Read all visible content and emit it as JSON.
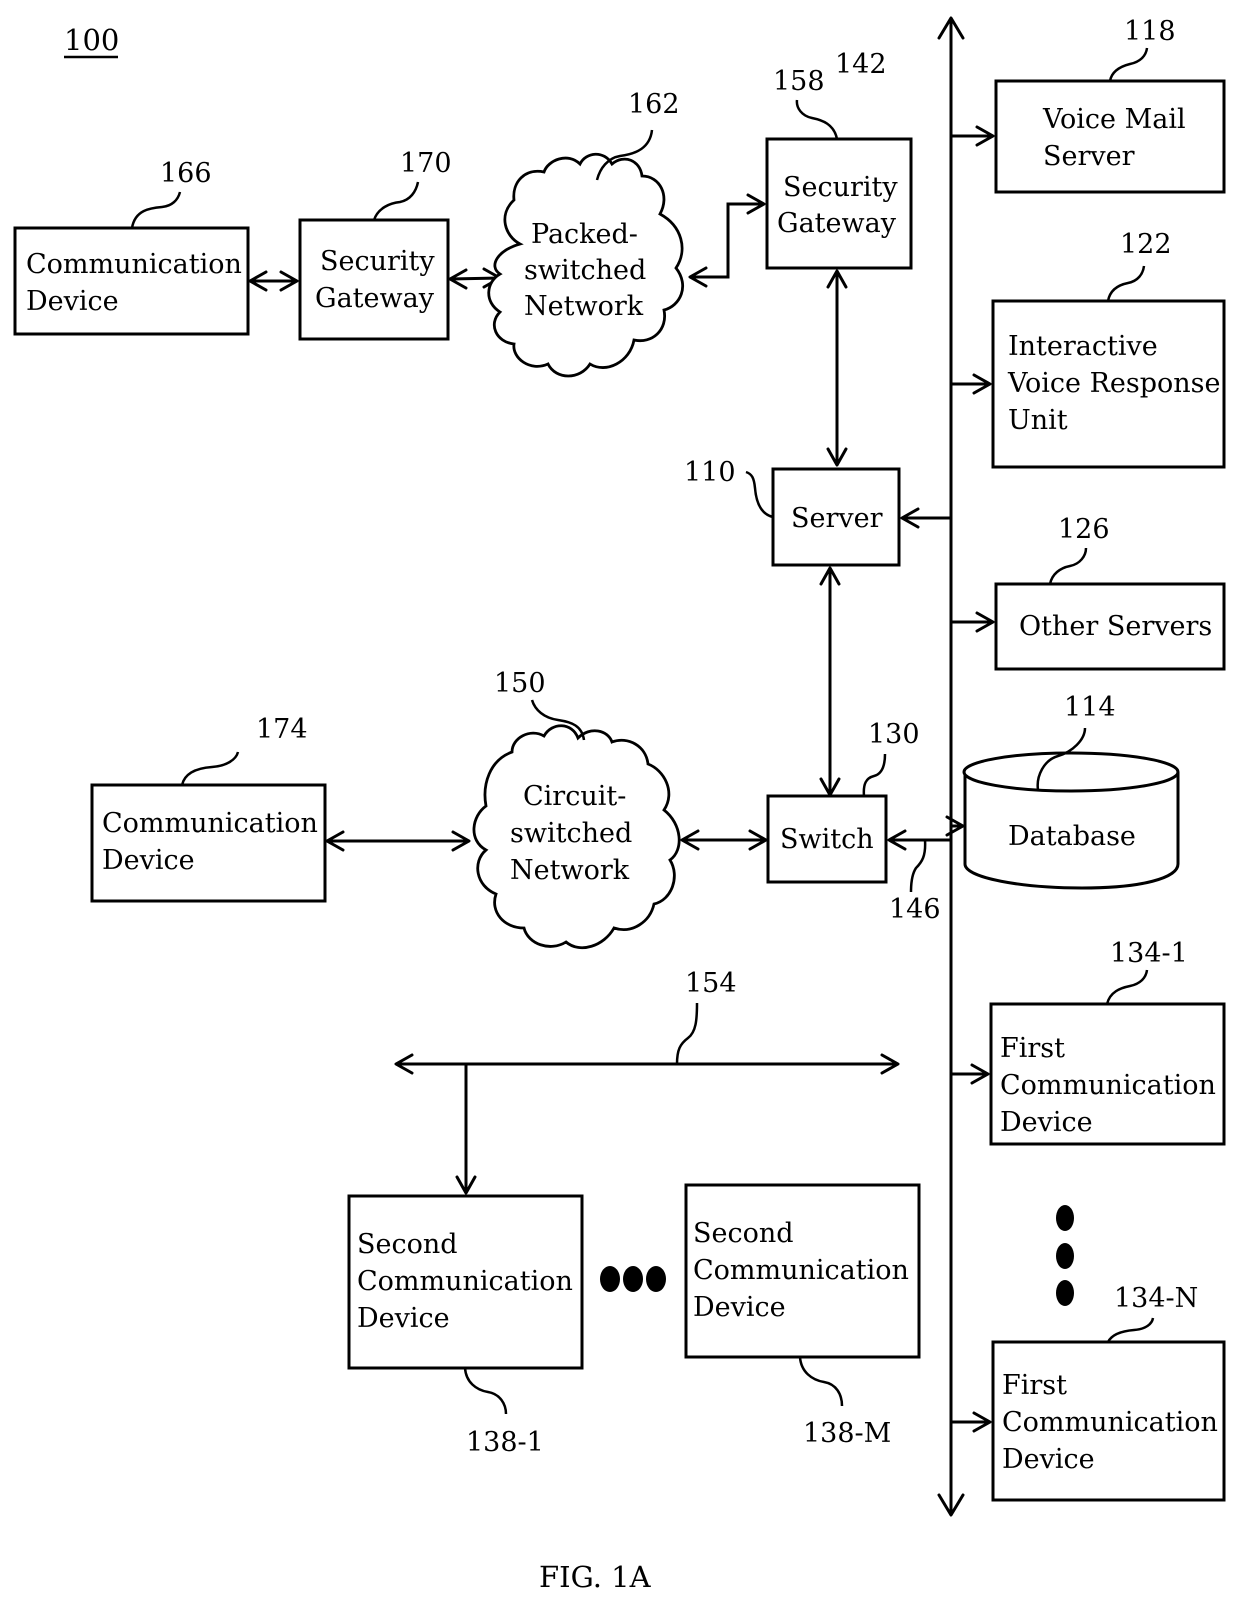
{
  "figure": {
    "number_label": "100",
    "caption": "FIG. 1A",
    "system_ref": "142"
  },
  "nodes": {
    "comm_device_166": {
      "ref": "166",
      "lines": [
        "Communication",
        "Device"
      ]
    },
    "security_gateway_170": {
      "ref": "170",
      "lines": [
        "Security",
        "Gateway"
      ]
    },
    "packet_network_162": {
      "ref": "162",
      "lines": [
        "Packed-",
        "switched",
        "Network"
      ]
    },
    "security_gateway_158": {
      "ref": "158",
      "lines": [
        "Security",
        "Gateway"
      ]
    },
    "voice_mail_118": {
      "ref": "118",
      "lines": [
        "Voice Mail",
        "Server"
      ]
    },
    "ivr_122": {
      "ref": "122",
      "lines": [
        "Interactive",
        "Voice Response",
        "Unit"
      ]
    },
    "server_110": {
      "ref": "110",
      "lines": [
        "Server"
      ]
    },
    "other_servers_126": {
      "ref": "126",
      "lines": [
        "Other Servers"
      ]
    },
    "comm_device_174": {
      "ref": "174",
      "lines": [
        "Communication",
        "Device"
      ]
    },
    "circuit_network_150": {
      "ref": "150",
      "lines": [
        "Circuit-",
        "switched",
        "Network"
      ]
    },
    "switch_130": {
      "ref": "130",
      "lines": [
        "Switch"
      ]
    },
    "database_114": {
      "ref": "114",
      "lines": [
        "Database"
      ]
    },
    "bus_146": {
      "ref": "146"
    },
    "lan_154": {
      "ref": "154"
    },
    "first_comm_134_1": {
      "ref": "134-1",
      "lines": [
        "First",
        "Communication",
        "Device"
      ]
    },
    "first_comm_134_n": {
      "ref": "134-N",
      "lines": [
        "First",
        "Communication",
        "Device"
      ]
    },
    "second_comm_138_1": {
      "ref": "138-1",
      "lines": [
        "Second",
        "Communication",
        "Device"
      ]
    },
    "second_comm_138_m": {
      "ref": "138-M",
      "lines": [
        "Second",
        "Communication",
        "Device"
      ]
    }
  }
}
